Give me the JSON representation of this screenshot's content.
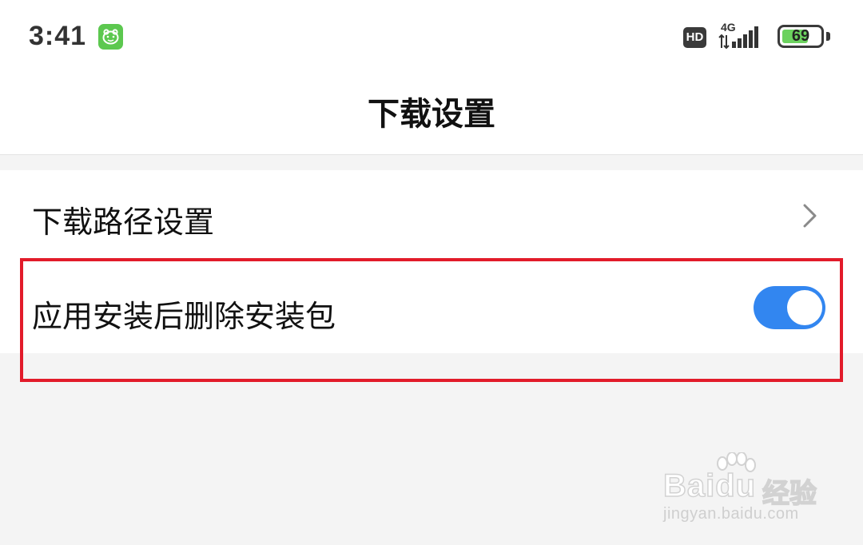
{
  "status_bar": {
    "time": "3:41",
    "hd": "HD",
    "network": "4G",
    "battery_percent": "69",
    "battery_level": 0.69,
    "icons": [
      "app-notification-icon",
      "hd-icon",
      "signal-icon",
      "battery-icon"
    ]
  },
  "header": {
    "title": "下载设置"
  },
  "settings": {
    "items": [
      {
        "label": "下载路径设置",
        "control": "chevron-right-icon"
      },
      {
        "label": "应用安装后删除安装包",
        "control": "toggle",
        "enabled": true
      }
    ]
  },
  "watermark": {
    "brand": "Baidu",
    "product": "经验",
    "url": "jingyan.baidu.com"
  },
  "colors": {
    "toggle_on": "#3286f0",
    "highlight": "#e21b2a",
    "battery": "#6cd25f",
    "app_notification": "#5cc84f"
  }
}
